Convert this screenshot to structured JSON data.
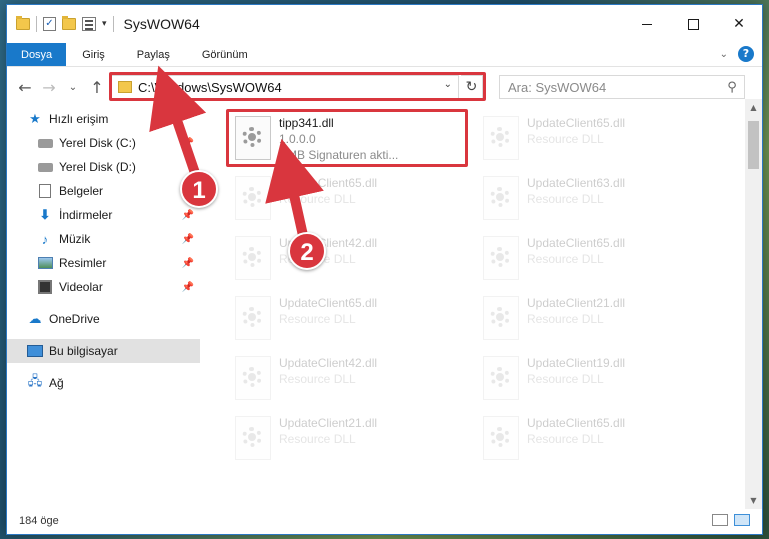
{
  "window": {
    "title": "SysWOW64"
  },
  "quick_access_toolbar": {
    "items": [
      "folder-icon",
      "check-icon",
      "folder-icon",
      "properties-icon",
      "customize-arrow"
    ]
  },
  "ribbon": {
    "tabs": [
      "Dosya",
      "Giriş",
      "Paylaş",
      "Görünüm"
    ]
  },
  "address": {
    "path": "C:\\Windows\\SysWOW64"
  },
  "search": {
    "placeholder": "Ara: SysWOW64"
  },
  "sidebar": {
    "quick_access": "Hızlı erişim",
    "items": [
      {
        "label": "Yerel Disk (C:)",
        "icon": "disk-icon",
        "pinned": true
      },
      {
        "label": "Yerel Disk (D:)",
        "icon": "disk-icon",
        "pinned": false
      },
      {
        "label": "Belgeler",
        "icon": "documents-icon",
        "pinned": true
      },
      {
        "label": "İndirmeler",
        "icon": "downloads-icon",
        "pinned": true
      },
      {
        "label": "Müzik",
        "icon": "music-icon",
        "pinned": true
      },
      {
        "label": "Resimler",
        "icon": "pictures-icon",
        "pinned": true
      },
      {
        "label": "Videolar",
        "icon": "videos-icon",
        "pinned": true
      }
    ],
    "onedrive": "OneDrive",
    "this_pc": "Bu bilgisayar",
    "network": "Ağ"
  },
  "files": {
    "highlighted": {
      "name": "tipp341.dll",
      "version": "1.0.0.0",
      "description": "SMB Signaturen akti..."
    },
    "faded": [
      {
        "name": "UpdateClient65.dll",
        "type": "Resource DLL"
      },
      {
        "name": "UpdateClient65.dll",
        "type": "Resource DLL"
      },
      {
        "name": "UpdateClient63.dll",
        "type": "Resource DLL"
      },
      {
        "name": "UpdateClient42.dll",
        "type": "Resource DLL"
      },
      {
        "name": "UpdateClient65.dll",
        "type": "Resource DLL"
      },
      {
        "name": "UpdateClient65.dll",
        "type": "Resource DLL"
      },
      {
        "name": "UpdateClient21.dll",
        "type": "Resource DLL"
      },
      {
        "name": "UpdateClient42.dll",
        "type": "Resource DLL"
      },
      {
        "name": "UpdateClient19.dll",
        "type": "Resource DLL"
      },
      {
        "name": "UpdateClient21.dll",
        "type": "Resource DLL"
      },
      {
        "name": "UpdateClient65.dll",
        "type": "Resource DLL"
      }
    ]
  },
  "status": {
    "item_count": "184 öge"
  },
  "annotations": {
    "step1": "1",
    "step2": "2",
    "color": "#d9363e"
  }
}
